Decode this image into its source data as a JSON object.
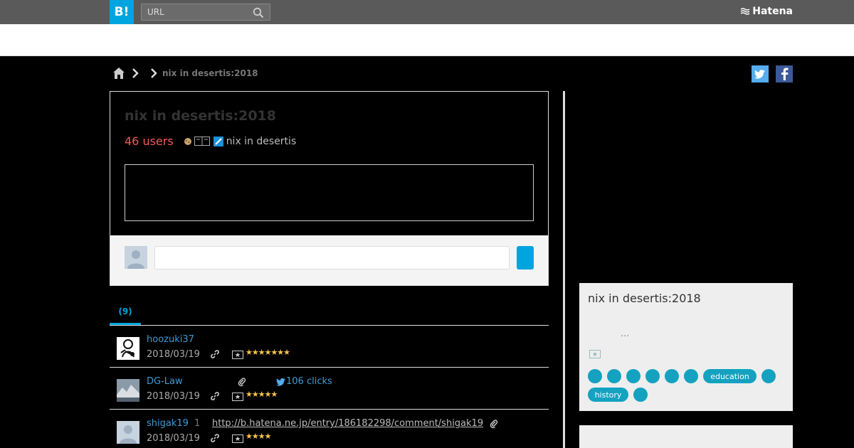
{
  "header": {
    "logo": "B!",
    "search_placeholder": "URL",
    "brand": "Hatena"
  },
  "breadcrumb": {
    "current": "nix in desertis:2018"
  },
  "social": {
    "twitter": "t",
    "facebook": "f"
  },
  "entry": {
    "title": "nix in desertis:2018",
    "users": "46 users",
    "site": "nix in desertis"
  },
  "tabs": [
    {
      "label": "(9)"
    }
  ],
  "bookmarks": [
    {
      "user": "hoozuki37",
      "date": "2018/03/19",
      "stars": "★★★★★★★",
      "extra": ""
    },
    {
      "user": "DG-Law",
      "date": "2018/03/19",
      "stars": "★★★★★",
      "extra": "106 clicks"
    },
    {
      "user": "shigak19",
      "date": "2018/03/19",
      "stars": "★★★★",
      "count": "1",
      "extra": "http://b.hatena.ne.jp/entry/186182298/comment/shigak19"
    }
  ],
  "sidebar": {
    "title": "nix in desertis:2018",
    "ellipsis": "...",
    "tags": [
      {
        "label": ""
      },
      {
        "label": ""
      },
      {
        "label": ""
      },
      {
        "label": ""
      },
      {
        "label": ""
      },
      {
        "label": ""
      },
      {
        "label": "education"
      },
      {
        "label": ""
      },
      {
        "label": "history"
      },
      {
        "label": ""
      }
    ]
  },
  "colors": {
    "accent": "#00a4de",
    "users_red": "#f05b5b",
    "tag": "#14a2c0",
    "topbar": "#5a5a5a",
    "star": "#f7c54b"
  }
}
